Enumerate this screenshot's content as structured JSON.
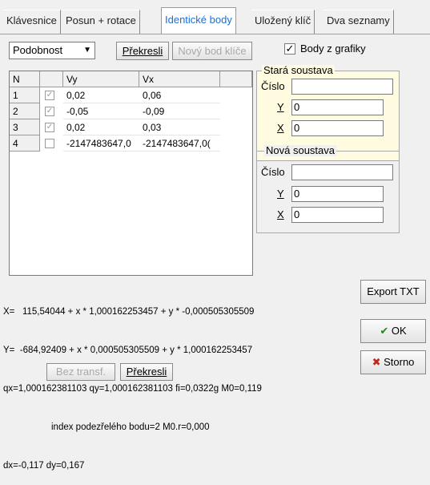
{
  "tabs": [
    {
      "label": "Klávesnice"
    },
    {
      "label": "Posun + rotace"
    },
    {
      "label": "Identické body"
    },
    {
      "label": "Uložený klíč"
    },
    {
      "label": "Dva seznamy"
    }
  ],
  "toolbar": {
    "transform_selected": "Podobnost",
    "redraw_label": "Překresli",
    "new_key_point_label": "Nový bod klíče",
    "points_from_graphics_label": "Body z grafiky",
    "points_from_graphics_checked": true
  },
  "grid": {
    "headers": [
      "N",
      "",
      "Vy",
      "Vx"
    ],
    "rows": [
      {
        "n": "1",
        "checked": true,
        "vy": "0,02",
        "vx": "0,06"
      },
      {
        "n": "2",
        "checked": true,
        "vy": "-0,05",
        "vx": "-0,09"
      },
      {
        "n": "3",
        "checked": true,
        "vy": "0,02",
        "vx": "0,03"
      },
      {
        "n": "4",
        "checked": false,
        "vy": "-2147483647,0",
        "vx": "-2147483647,0("
      }
    ]
  },
  "old_system": {
    "title": "Stará soustava",
    "number_label": "Číslo",
    "number_value": "",
    "y_label": "Y",
    "y_value": "0",
    "x_label": "X",
    "x_value": "0"
  },
  "new_system": {
    "title": "Nová soustava",
    "number_label": "Číslo",
    "number_value": "",
    "y_label": "Y",
    "y_value": "0",
    "x_label": "X",
    "x_value": "0"
  },
  "results": {
    "line1": "X=   115,54044 + x * 1,000162253457 + y * -0,000505305509",
    "line2": "Y=  -684,92409 + x * 0,000505305509 + y * 1,000162253457",
    "line3": "qx=1,000162381103 qy=1,000162381103 fi=0,0322g M0=0,119",
    "line4": "index podezřelého bodu=2 M0.r=0,000",
    "line5": "dx=-0,117 dy=0,167"
  },
  "buttons": {
    "export_txt": "Export TXT",
    "ok": "OK",
    "cancel": "Storno",
    "no_transform": "Bez transf.",
    "redraw_bottom": "Překresli"
  },
  "colors": {
    "active_tab": "#1a6fd6",
    "old_system_bg": "#fffbe0",
    "ok_icon": "#1f8a1f",
    "cancel_icon": "#c0271b"
  }
}
